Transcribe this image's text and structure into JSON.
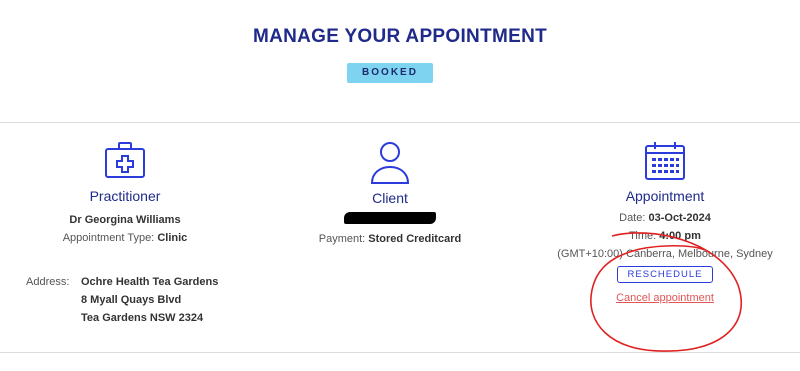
{
  "header": {
    "title": "MANAGE YOUR APPOINTMENT",
    "status": "BOOKED"
  },
  "practitioner": {
    "heading": "Practitioner",
    "name": "Dr Georgina Williams",
    "type_label": "Appointment Type:",
    "type_value": "Clinic",
    "address_label": "Address:",
    "address_lines": [
      "Ochre Health Tea Gardens",
      "8 Myall Quays Blvd",
      "Tea Gardens NSW 2324"
    ],
    "icon": "medical-kit-icon"
  },
  "client": {
    "heading": "Client",
    "payment_label": "Payment:",
    "payment_value": "Stored Creditcard",
    "icon": "user-icon"
  },
  "appointment": {
    "heading": "Appointment",
    "date_label": "Date:",
    "date_value": "03-Oct-2024",
    "time_label": "Time:",
    "time_value": "4:00 pm",
    "timezone": "(GMT+10:00) Canberra, Melbourne, Sydney",
    "reschedule_label": "RESCHEDULE",
    "cancel_label": "Cancel appointment",
    "icon": "calendar-icon"
  },
  "colors": {
    "accent": "#2c3bdc",
    "heading": "#1f2a8a",
    "badge": "#7dd3f0",
    "cancel": "#e05656",
    "annotation": "#e02020"
  }
}
